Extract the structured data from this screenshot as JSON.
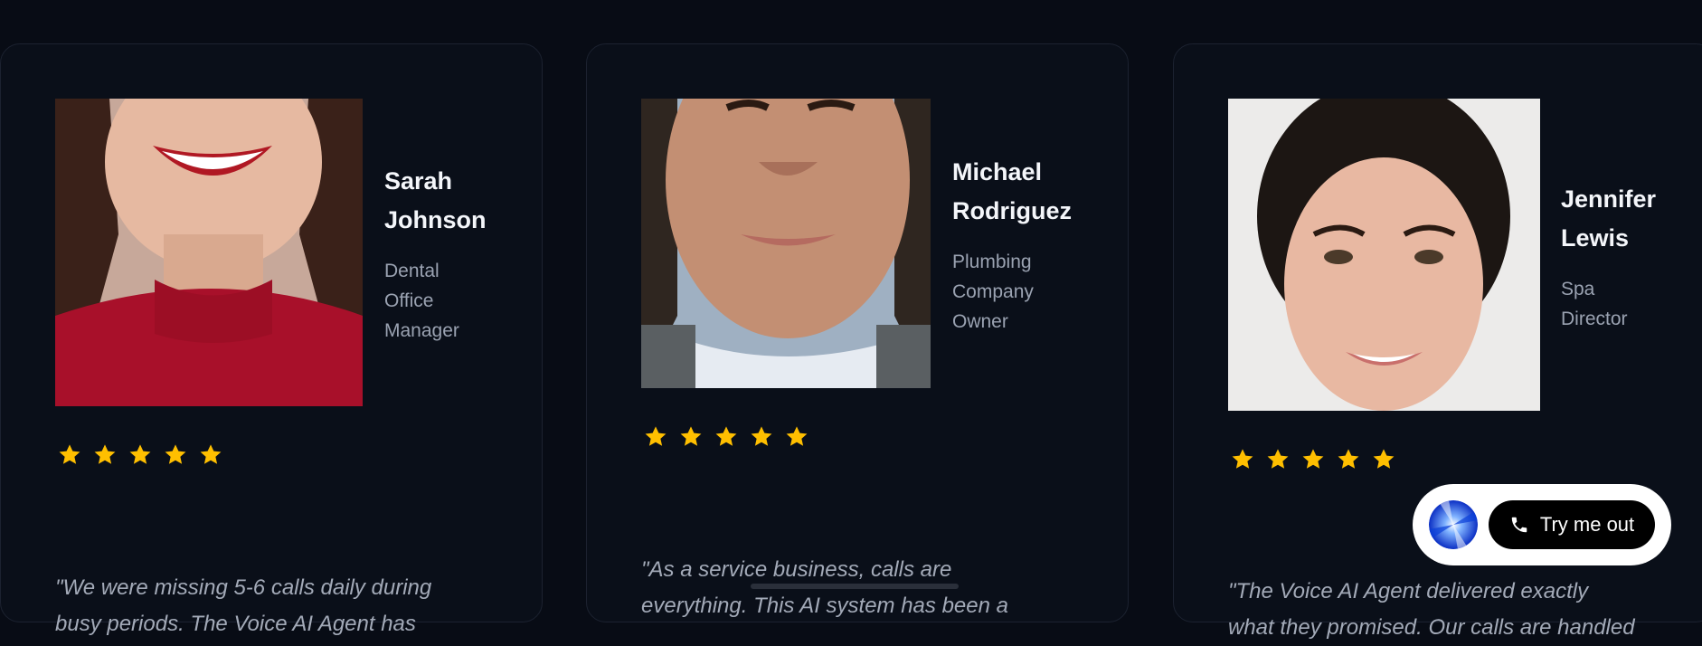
{
  "testimonials": [
    {
      "name_line1": "Sarah",
      "name_line2": "Johnson",
      "role_lines": [
        "Dental",
        "Office",
        "Manager"
      ],
      "rating": 5,
      "quote_line1": "\"We were missing 5-6 calls daily during",
      "quote_line2": "busy periods. The Voice AI Agent has"
    },
    {
      "name_line1": "Michael",
      "name_line2": "Rodriguez",
      "role_lines": [
        "Plumbing",
        "Company",
        "Owner"
      ],
      "rating": 5,
      "quote_line1": "\"As a service business, calls are",
      "quote_line2": "everything. This AI system has been a"
    },
    {
      "name_line1": "Jennifer",
      "name_line2": "Lewis",
      "role_lines": [
        "Spa",
        "Director"
      ],
      "rating": 5,
      "quote_line1": "\"The Voice AI Agent delivered exactly",
      "quote_line2": "what they promised. Our calls are handled"
    }
  ],
  "widget": {
    "button_label": "Try me out",
    "icon": "phone-icon"
  },
  "colors": {
    "background": "#080c15",
    "card": "#0a0f19",
    "star": "#ffbf00",
    "accent_blue": "#1f4fe0"
  }
}
